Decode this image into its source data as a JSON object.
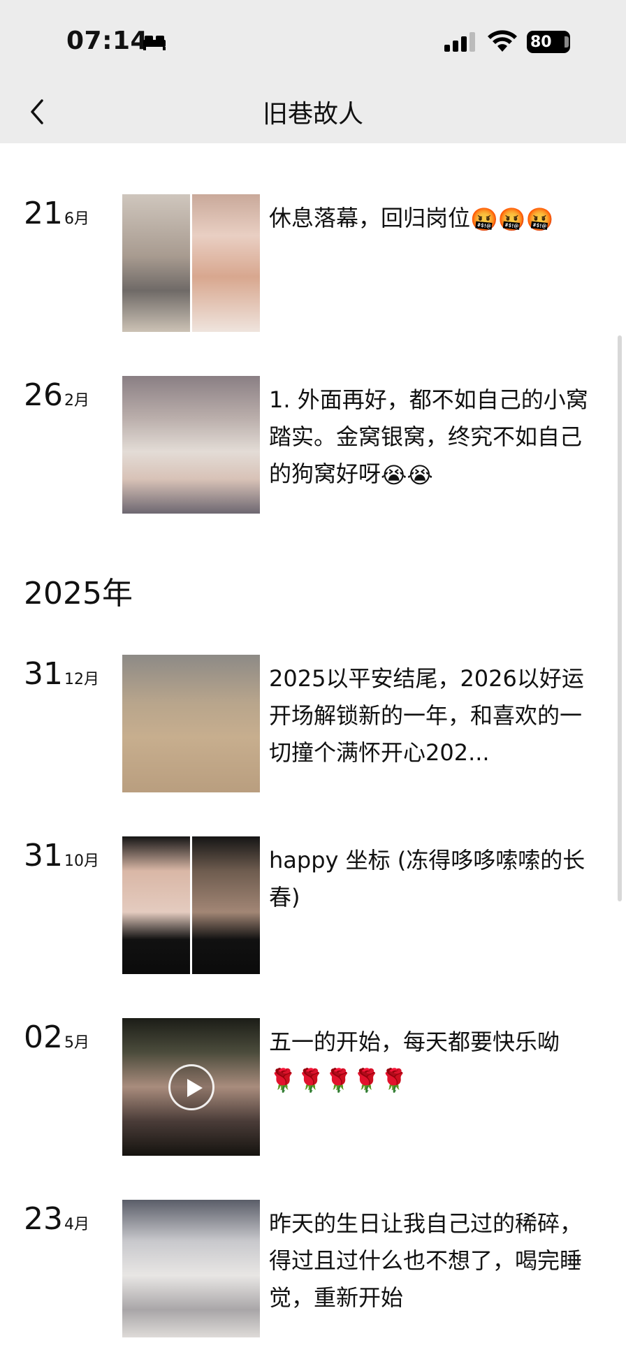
{
  "status_bar": {
    "time": "07:14",
    "battery": "80"
  },
  "header": {
    "title": "旧巷故人"
  },
  "sections": {
    "year_2025": "2025年"
  },
  "posts": [
    {
      "day": "21",
      "month": "6月",
      "text": "休息落幕，回归岗位",
      "emoji": "🤬🤬🤬"
    },
    {
      "day": "26",
      "month": "2月",
      "text": "1. 外面再好，都不如自己的小窝踏实。金窝银窝，终究不如自己的狗窝好呀",
      "emoji": "😭😭"
    },
    {
      "day": "31",
      "month": "12月",
      "text": "2025以平安结尾，2026以好运开场解锁新的一年，和喜欢的一切撞个满怀开心202...",
      "emoji": ""
    },
    {
      "day": "31",
      "month": "10月",
      "text": "happy  坐标 (冻得哆哆嗦嗦的长春)",
      "emoji": ""
    },
    {
      "day": "02",
      "month": "5月",
      "text": "五一的开始，每天都要快乐呦",
      "emoji": "🌹🌹🌹🌹🌹"
    },
    {
      "day": "23",
      "month": "4月",
      "text": "昨天的生日让我自己过的稀碎，得过且过什么也不想了，喝完睡觉，重新开始",
      "emoji": ""
    }
  ],
  "colors": {
    "header_bg": "#ececec",
    "text": "#111111",
    "page_bg": "#ffffff"
  },
  "icons": [
    "chevron-left-icon",
    "bed-icon",
    "signal-icon",
    "wifi-icon",
    "battery-icon",
    "play-icon"
  ]
}
